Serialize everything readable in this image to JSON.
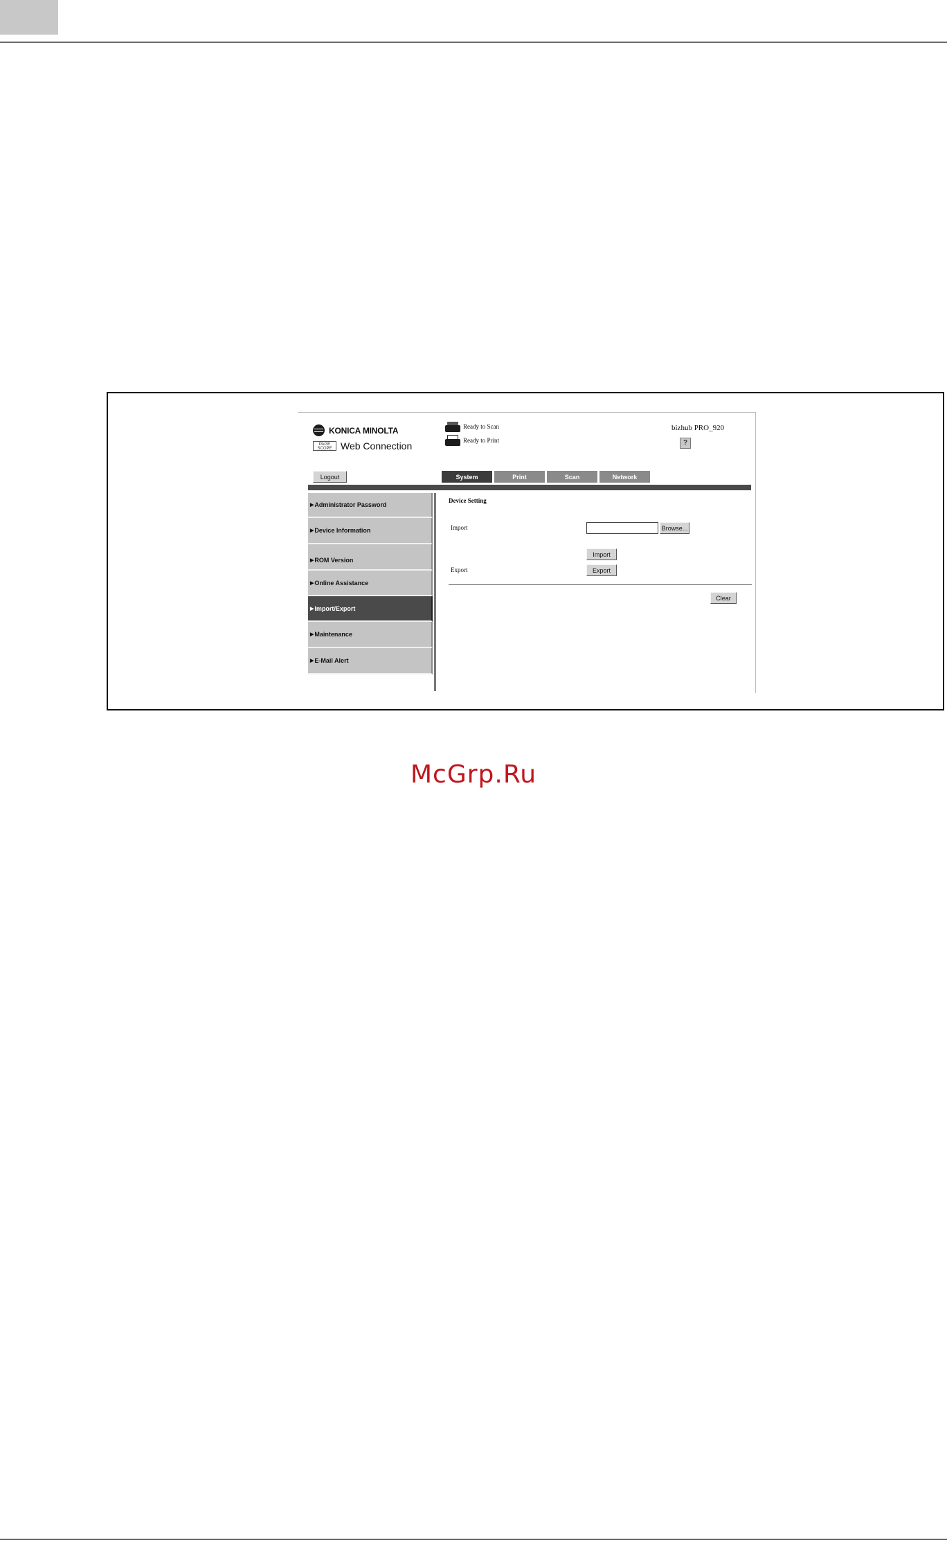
{
  "header": {
    "brand": "KONICA MINOLTA",
    "product_mark": "PAGE SCOPE",
    "product": "Web Connection",
    "status_scan": "Ready to Scan",
    "status_print": "Ready to Print",
    "model": "bizhub PRO_920",
    "help_label": "?"
  },
  "toolbar": {
    "logout_label": "Logout"
  },
  "tabs": [
    {
      "label": "System",
      "active": true
    },
    {
      "label": "Print",
      "active": false
    },
    {
      "label": "Scan",
      "active": false
    },
    {
      "label": "Network",
      "active": false
    }
  ],
  "sidebar": {
    "items": [
      {
        "label": "Administrator Password",
        "active": false
      },
      {
        "label": "Device Information",
        "active": false
      },
      {
        "label": "ROM Version",
        "active": false
      },
      {
        "label": "Online Assistance",
        "active": false
      },
      {
        "label": "Import/Export",
        "active": true
      },
      {
        "label": "Maintenance",
        "active": false
      },
      {
        "label": "E-Mail Alert",
        "active": false
      }
    ]
  },
  "content": {
    "title": "Device Setting",
    "import_label": "Import",
    "export_label": "Export",
    "file_value": "",
    "browse_label": "Browse...",
    "import_button": "Import",
    "export_button": "Export",
    "clear_button": "Clear"
  },
  "watermark": "McGrp.Ru"
}
